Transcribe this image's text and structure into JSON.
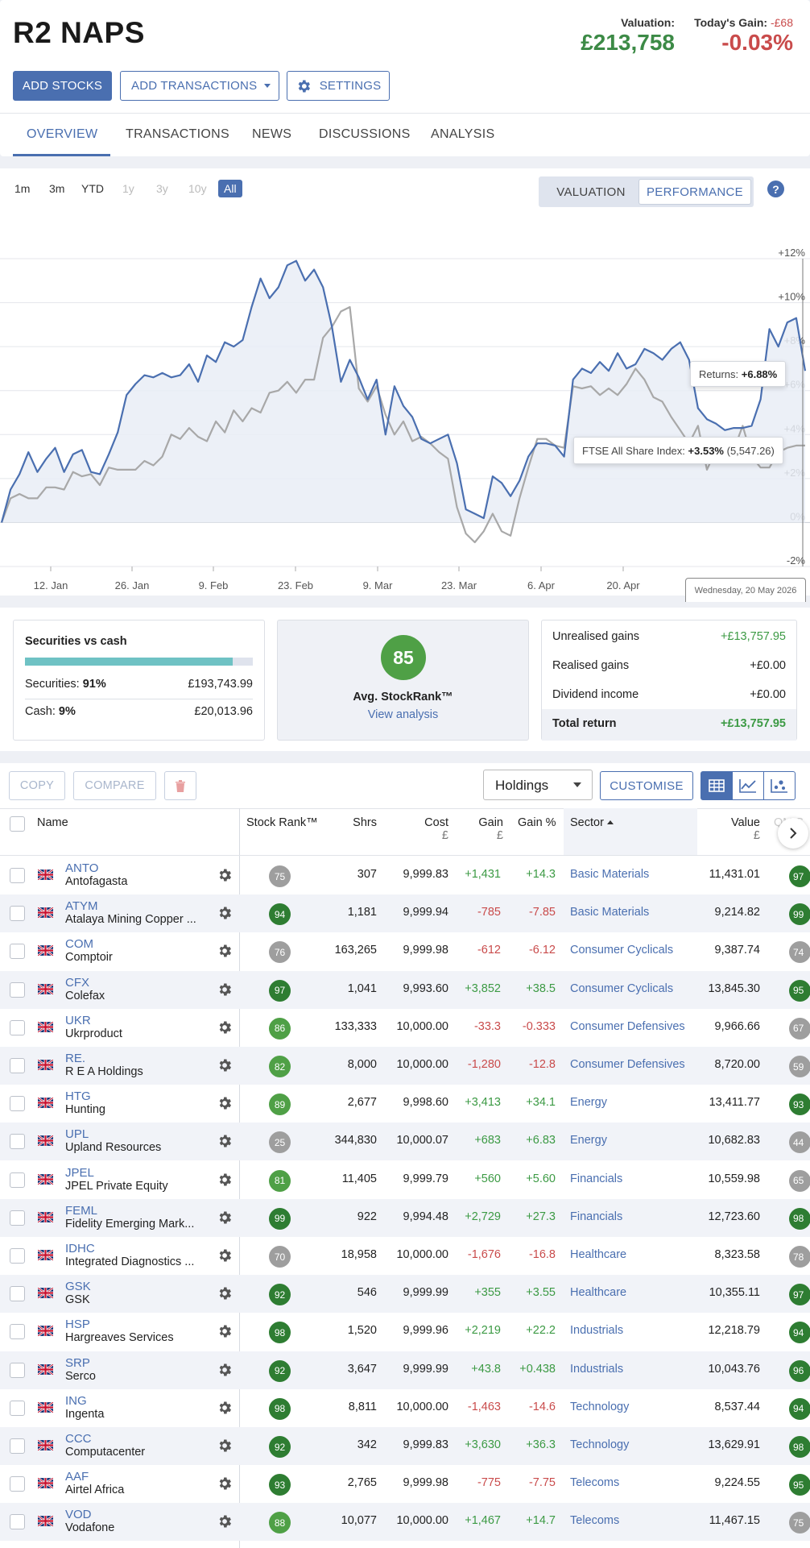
{
  "portfolio": {
    "title": "R2 NAPS",
    "valuation_label": "Valuation:",
    "valuation": "£213,758",
    "todays_gain_label": "Today's Gain:",
    "todays_gain_abs": "-£68",
    "todays_gain_pct": "-0.03%"
  },
  "actions": {
    "add_stocks": "ADD STOCKS",
    "add_transactions": "ADD TRANSACTIONS",
    "settings": "SETTINGS"
  },
  "tabs": [
    {
      "label": "OVERVIEW"
    },
    {
      "label": "TRANSACTIONS"
    },
    {
      "label": "NEWS"
    },
    {
      "label": "DISCUSSIONS"
    },
    {
      "label": "ANALYSIS"
    }
  ],
  "chart_controls": {
    "ranges": [
      "1m",
      "3m",
      "YTD",
      "1y",
      "3y",
      "10y",
      "All"
    ],
    "selected_range": "All",
    "modes": [
      "VALUATION",
      "PERFORMANCE"
    ],
    "selected_mode": "PERFORMANCE",
    "help": "?"
  },
  "chart_data": {
    "type": "line",
    "x_tick_labels": [
      "12. Jan",
      "26. Jan",
      "9. Feb",
      "23. Feb",
      "9. Mar",
      "23. Mar",
      "6. Apr",
      "20. Apr"
    ],
    "y_tick_labels": [
      "+12%",
      "+10%",
      "+8%",
      "+6%",
      "+4%",
      "+2%",
      "0%",
      "-2%"
    ],
    "ylim": [
      -2,
      12
    ],
    "series": [
      {
        "name": "Returns",
        "color": "#4a6fb0",
        "values": [
          0,
          1.5,
          2.2,
          3.2,
          2.3,
          2.9,
          3.4,
          2.3,
          3.1,
          3.3,
          2.3,
          2.2,
          3.1,
          4.1,
          5.8,
          6.3,
          6.7,
          6.6,
          6.8,
          6.6,
          6.7,
          7.2,
          6.4,
          7.6,
          7.3,
          8.2,
          8.0,
          8.3,
          9.8,
          11.1,
          10.2,
          10.7,
          11.7,
          11.9,
          11.0,
          11.5,
          10.7,
          8.9,
          6.4,
          7.4,
          6.6,
          5.6,
          6.5,
          4.0,
          6.2,
          5.3,
          4.8,
          3.8,
          3.6,
          3.8,
          4.0,
          2.7,
          0.6,
          0.4,
          0.2,
          2.1,
          1.8,
          1.2,
          1.9,
          3.0,
          3.6,
          3.6,
          3.5,
          3.0,
          6.5,
          7.0,
          6.8,
          7.3,
          6.9,
          7.7,
          7.0,
          7.2,
          7.9,
          7.7,
          7.4,
          7.9,
          8.2,
          7.4,
          5.2,
          4.7,
          4.5,
          4.2,
          4.3,
          4.3,
          4.4,
          5.6,
          8.8,
          8.0,
          9.1,
          9.3,
          6.9
        ]
      },
      {
        "name": "FTSE All Share Index",
        "color": "#a8a8a8",
        "values": [
          0,
          1.1,
          1.3,
          1.1,
          1.1,
          1.6,
          1.6,
          1.5,
          2.3,
          2.1,
          2.2,
          1.7,
          2.5,
          2.4,
          2.4,
          2.4,
          2.8,
          2.6,
          3.0,
          4.0,
          3.8,
          4.3,
          3.9,
          3.7,
          4.6,
          4.1,
          5.1,
          4.6,
          5.2,
          5.0,
          5.9,
          6.0,
          6.4,
          5.9,
          6.5,
          6.5,
          8.4,
          8.9,
          9.6,
          9.8,
          6.1,
          5.5,
          6.2,
          4.9,
          4.0,
          4.6,
          3.7,
          3.9,
          3.6,
          3.2,
          2.9,
          0.7,
          -0.5,
          -0.9,
          -0.4,
          0.4,
          -0.4,
          -0.6,
          1.1,
          2.5,
          3.8,
          3.8,
          3.5,
          3.4,
          6.2,
          6.1,
          6.2,
          5.8,
          6.1,
          5.8,
          6.3,
          7.0,
          6.5,
          5.7,
          5.5,
          4.8,
          4.2,
          3.6,
          4.4,
          2.4,
          3.3,
          3.4,
          3.3,
          4.4,
          3.0,
          2.5,
          2.5,
          3.2,
          3.4,
          3.5,
          3.5
        ]
      }
    ],
    "tooltips": {
      "returns_label": "Returns:",
      "returns_value": "+6.88%",
      "index_label": "FTSE All Share Index:",
      "index_value": "+3.53%",
      "index_level": "(5,547.26)"
    },
    "crosshair_date": "Wednesday, 20 May 2026"
  },
  "summary": {
    "securities_vs_cash": {
      "title": "Securities vs cash",
      "securities_fraction": 0.91,
      "securities_label": "Securities:",
      "securities_pct": "91%",
      "securities_value": "£193,743.99",
      "cash_label": "Cash:",
      "cash_pct": "9%",
      "cash_value": "£20,013.96"
    },
    "stockrank": {
      "value": "85",
      "label": "Avg. StockRank™",
      "link": "View analysis"
    },
    "returns": [
      {
        "label": "Unrealised gains",
        "value": "+£13,757.95"
      },
      {
        "label": "Realised gains",
        "value": "+£0.00"
      },
      {
        "label": "Dividend income",
        "value": "+£0.00"
      },
      {
        "label": "Total return",
        "value": "+£13,757.95"
      }
    ]
  },
  "table_toolbar": {
    "copy": "COPY",
    "compare": "COMPARE",
    "view_select": "Holdings",
    "customise": "CUSTOMISE"
  },
  "table": {
    "headers": {
      "name": "Name",
      "stockrank": "Stock Rank™",
      "shares": "Shrs",
      "cost": "Cost",
      "cost_unit": "£",
      "gain": "Gain",
      "gain_unit": "£",
      "gain_pct": "Gain %",
      "sector": "Sector",
      "value": "Value",
      "value_unit": "£",
      "qm": "QM S"
    },
    "rows": [
      {
        "ticker": "ANTO",
        "name": "Antofagasta",
        "rank": "75",
        "shares": "307",
        "cost": "9,999.83",
        "gain": "+1,431",
        "gain_pct": "+14.3",
        "sector": "Basic Materials",
        "value": "11,431.01",
        "qm": "97"
      },
      {
        "ticker": "ATYM",
        "name": "Atalaya Mining Copper ...",
        "rank": "94",
        "shares": "1,181",
        "cost": "9,999.94",
        "gain": "-785",
        "gain_pct": "-7.85",
        "sector": "Basic Materials",
        "value": "9,214.82",
        "qm": "99"
      },
      {
        "ticker": "COM",
        "name": "Comptoir",
        "rank": "76",
        "shares": "163,265",
        "cost": "9,999.98",
        "gain": "-612",
        "gain_pct": "-6.12",
        "sector": "Consumer Cyclicals",
        "value": "9,387.74",
        "qm": "74"
      },
      {
        "ticker": "CFX",
        "name": "Colefax",
        "rank": "97",
        "shares": "1,041",
        "cost": "9,993.60",
        "gain": "+3,852",
        "gain_pct": "+38.5",
        "sector": "Consumer Cyclicals",
        "value": "13,845.30",
        "qm": "95"
      },
      {
        "ticker": "UKR",
        "name": "Ukrproduct",
        "rank": "86",
        "shares": "133,333",
        "cost": "10,000.00",
        "gain": "-33.3",
        "gain_pct": "-0.333",
        "sector": "Consumer Defensives",
        "value": "9,966.66",
        "qm": "67"
      },
      {
        "ticker": "RE.",
        "name": "R E A Holdings",
        "rank": "82",
        "shares": "8,000",
        "cost": "10,000.00",
        "gain": "-1,280",
        "gain_pct": "-12.8",
        "sector": "Consumer Defensives",
        "value": "8,720.00",
        "qm": "59"
      },
      {
        "ticker": "HTG",
        "name": "Hunting",
        "rank": "89",
        "shares": "2,677",
        "cost": "9,998.60",
        "gain": "+3,413",
        "gain_pct": "+34.1",
        "sector": "Energy",
        "value": "13,411.77",
        "qm": "93"
      },
      {
        "ticker": "UPL",
        "name": "Upland Resources",
        "rank": "25",
        "shares": "344,830",
        "cost": "10,000.07",
        "gain": "+683",
        "gain_pct": "+6.83",
        "sector": "Energy",
        "value": "10,682.83",
        "qm": "44"
      },
      {
        "ticker": "JPEL",
        "name": "JPEL Private Equity",
        "rank": "81",
        "shares": "11,405",
        "cost": "9,999.79",
        "gain": "+560",
        "gain_pct": "+5.60",
        "sector": "Financials",
        "value": "10,559.98",
        "qm": "65"
      },
      {
        "ticker": "FEML",
        "name": "Fidelity Emerging Mark...",
        "rank": "99",
        "shares": "922",
        "cost": "9,994.48",
        "gain": "+2,729",
        "gain_pct": "+27.3",
        "sector": "Financials",
        "value": "12,723.60",
        "qm": "98"
      },
      {
        "ticker": "IDHC",
        "name": "Integrated Diagnostics ...",
        "rank": "70",
        "shares": "18,958",
        "cost": "10,000.00",
        "gain": "-1,676",
        "gain_pct": "-16.8",
        "sector": "Healthcare",
        "value": "8,323.58",
        "qm": "78"
      },
      {
        "ticker": "GSK",
        "name": "GSK",
        "rank": "92",
        "shares": "546",
        "cost": "9,999.99",
        "gain": "+355",
        "gain_pct": "+3.55",
        "sector": "Healthcare",
        "value": "10,355.11",
        "qm": "97"
      },
      {
        "ticker": "HSP",
        "name": "Hargreaves Services",
        "rank": "98",
        "shares": "1,520",
        "cost": "9,999.96",
        "gain": "+2,219",
        "gain_pct": "+22.2",
        "sector": "Industrials",
        "value": "12,218.79",
        "qm": "94"
      },
      {
        "ticker": "SRP",
        "name": "Serco",
        "rank": "92",
        "shares": "3,647",
        "cost": "9,999.99",
        "gain": "+43.8",
        "gain_pct": "+0.438",
        "sector": "Industrials",
        "value": "10,043.76",
        "qm": "96"
      },
      {
        "ticker": "ING",
        "name": "Ingenta",
        "rank": "98",
        "shares": "8,811",
        "cost": "10,000.00",
        "gain": "-1,463",
        "gain_pct": "-14.6",
        "sector": "Technology",
        "value": "8,537.44",
        "qm": "94"
      },
      {
        "ticker": "CCC",
        "name": "Computacenter",
        "rank": "92",
        "shares": "342",
        "cost": "9,999.83",
        "gain": "+3,630",
        "gain_pct": "+36.3",
        "sector": "Technology",
        "value": "13,629.91",
        "qm": "98"
      },
      {
        "ticker": "AAF",
        "name": "Airtel Africa",
        "rank": "93",
        "shares": "2,765",
        "cost": "9,999.98",
        "gain": "-775",
        "gain_pct": "-7.75",
        "sector": "Telecoms",
        "value": "9,224.55",
        "qm": "95"
      },
      {
        "ticker": "VOD",
        "name": "Vodafone",
        "rank": "88",
        "shares": "10,077",
        "cost": "10,000.00",
        "gain": "+1,467",
        "gain_pct": "+14.7",
        "sector": "Telecoms",
        "value": "11,467.15",
        "qm": "75"
      }
    ]
  }
}
